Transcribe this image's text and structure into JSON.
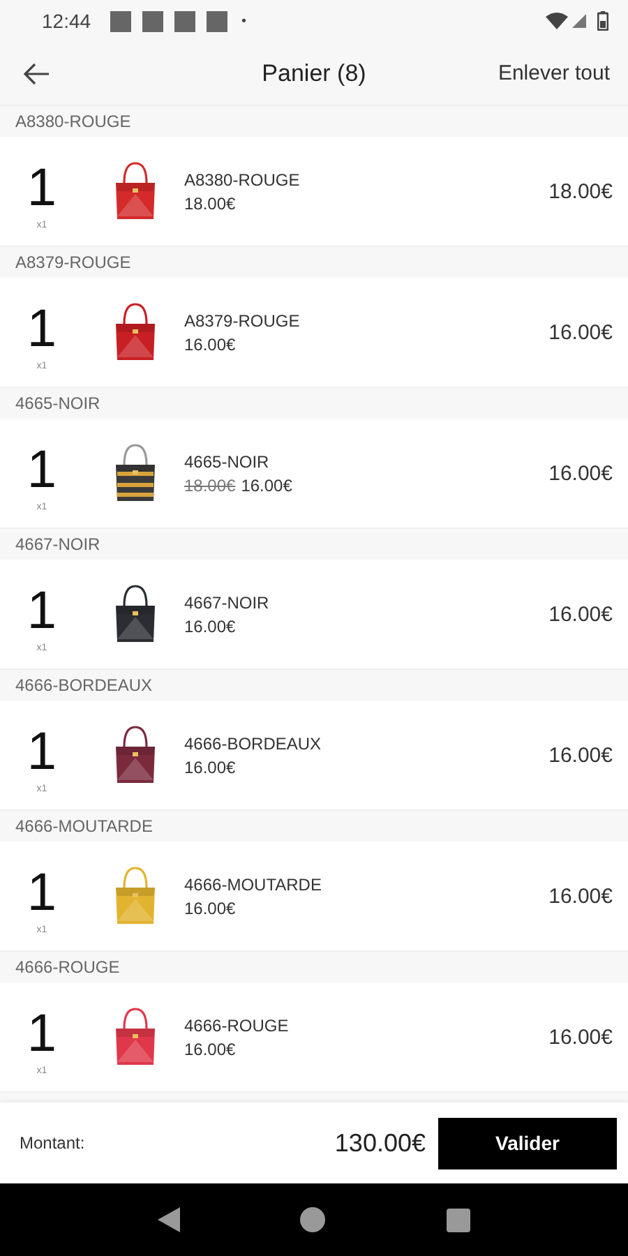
{
  "status_bar": {
    "time": "12:44",
    "dot": "•"
  },
  "toolbar": {
    "title": "Panier (8)",
    "action": "Enlever tout"
  },
  "items": [
    {
      "header": "A8380-ROUGE",
      "quantity": "1",
      "quantity_note": "x1",
      "name": "A8380-ROUGE",
      "price": "18.00€",
      "total": "18.00€"
    },
    {
      "header": "A8379-ROUGE",
      "quantity": "1",
      "quantity_note": "x1",
      "name": "A8379-ROUGE",
      "price": "16.00€",
      "total": "16.00€"
    },
    {
      "header": "4665-NOIR",
      "quantity": "1",
      "quantity_note": "x1",
      "name": "4665-NOIR",
      "old_price": "18.00€",
      "price": "16.00€",
      "total": "16.00€"
    },
    {
      "header": "4667-NOIR",
      "quantity": "1",
      "quantity_note": "x1",
      "name": "4667-NOIR",
      "price": "16.00€",
      "total": "16.00€"
    },
    {
      "header": "4666-BORDEAUX",
      "quantity": "1",
      "quantity_note": "x1",
      "name": "4666-BORDEAUX",
      "price": "16.00€",
      "total": "16.00€"
    },
    {
      "header": "4666-MOUTARDE",
      "quantity": "1",
      "quantity_note": "x1",
      "name": "4666-MOUTARDE",
      "price": "16.00€",
      "total": "16.00€"
    },
    {
      "header": "4666-ROUGE",
      "quantity": "1",
      "quantity_note": "x1",
      "name": "4666-ROUGE",
      "price": "16.00€",
      "total": "16.00€"
    }
  ],
  "footer": {
    "label": "Montant:",
    "amount": "130.00€",
    "button": "Valider"
  }
}
